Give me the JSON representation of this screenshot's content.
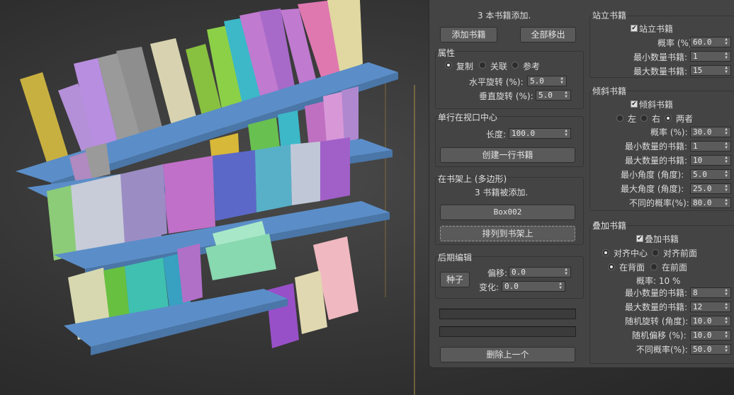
{
  "status_added": "3 本书籍添加.",
  "buttons": {
    "add_books": "添加书籍",
    "remove_all": "全部移出"
  },
  "props": {
    "title": "属性",
    "radios": [
      "复制",
      "关联",
      "参考"
    ],
    "selected": "复制",
    "hrot_label": "水平旋转 (%):",
    "hrot_value": "5.0",
    "vrot_label": "垂直旋转 (%):",
    "vrot_value": "5.0"
  },
  "row_center": {
    "title": "单行在视口中心",
    "length_label": "长度:",
    "length_value": "100.0",
    "create_row": "创建一行书籍"
  },
  "on_shelf": {
    "title": "在书架上 (多边形)",
    "status": "3 书籍被添加.",
    "object": "Box002",
    "arrange": "排列到书架上"
  },
  "post_edit": {
    "title": "后期编辑",
    "seed": "种子",
    "offset_label": "偏移:",
    "offset_value": "0.0",
    "change_label": "变化:",
    "change_value": "0.0"
  },
  "delete_last": "删除上一个",
  "standing": {
    "title": "站立书籍",
    "check": "站立书籍",
    "checked": true,
    "prob_label": "概率 (%):",
    "prob_value": "60.0",
    "min_label": "最小数量书籍:",
    "min_value": "1",
    "max_label": "最大数量书籍:",
    "max_value": "15"
  },
  "leaning": {
    "title": "倾斜书籍",
    "check": "倾斜书籍",
    "checked": true,
    "radios": [
      "左",
      "右",
      "两者"
    ],
    "selected": "两者",
    "prob_label": "概率 (%):",
    "prob_value": "30.0",
    "min_label": "最小数量的书籍:",
    "min_value": "1",
    "max_label": "最大数量的书籍:",
    "max_value": "10",
    "minang_label": "最小角度 (角度):",
    "minang_value": "5.0",
    "maxang_label": "最大角度 (角度):",
    "maxang_value": "25.0",
    "diff_label": "不同的概率(%):",
    "diff_value": "80.0"
  },
  "stacked": {
    "title": "叠加书籍",
    "check": "叠加书籍",
    "checked": true,
    "align_radios": [
      "对齐中心",
      "对齐前面"
    ],
    "align_selected": "对齐中心",
    "pos_radios": [
      "在背面",
      "在前面"
    ],
    "pos_selected": "在背面",
    "prob_text": "概率: 10 %",
    "min_label": "最小数量的书籍:",
    "min_value": "8",
    "max_label": "最大数量的书籍:",
    "max_value": "12",
    "rot_label": "随机旋转 (角度):",
    "rot_value": "10.0",
    "off_label": "随机偏移 (%):",
    "off_value": "10.0",
    "diff_label": "不同概率(%):",
    "diff_value": "50.0"
  },
  "colors": {
    "shelf": "#5b8ec8",
    "panel": "#444444",
    "viewport": "#333333"
  }
}
